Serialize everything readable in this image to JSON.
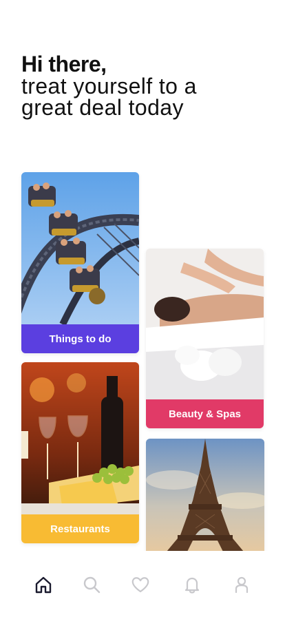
{
  "greeting": {
    "hi": "Hi there,",
    "line1": "treat yourself to a",
    "line2": "great deal today"
  },
  "categories": [
    {
      "label": "Things to do",
      "color": "#5b3fe0",
      "image": "rollercoaster"
    },
    {
      "label": "Beauty & Spas",
      "color": "#e13a67",
      "image": "massage"
    },
    {
      "label": "Restaurants",
      "color": "#f8bb33",
      "image": "wine-and-cheese"
    },
    {
      "label": "",
      "color": "#ffffff",
      "image": "eiffel-tower"
    }
  ],
  "tabbar": [
    {
      "name": "home",
      "active": true
    },
    {
      "name": "search",
      "active": false
    },
    {
      "name": "favorites",
      "active": false
    },
    {
      "name": "notifications",
      "active": false
    },
    {
      "name": "profile",
      "active": false
    }
  ],
  "colors": {
    "text": "#111111",
    "tab_active": "#1a1a2e",
    "tab_inactive": "#c8c8cc"
  }
}
